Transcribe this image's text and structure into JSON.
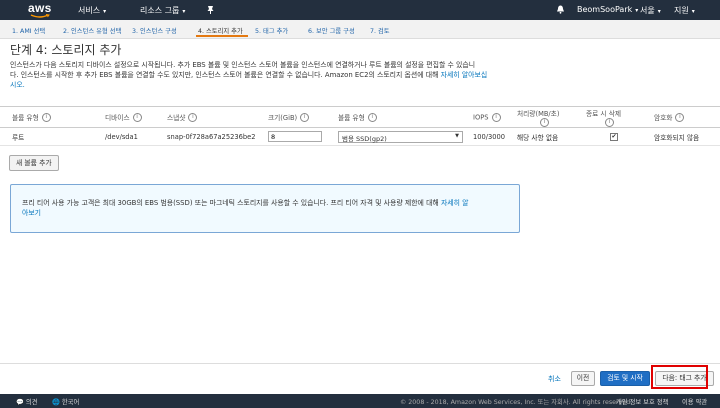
{
  "header": {
    "logo": "aws",
    "services": "서비스",
    "resource_groups": "리소스 그룹",
    "account": "BeomSooPark",
    "region": "서울",
    "support": "지원"
  },
  "steps": [
    "1. AMI 선택",
    "2. 인스턴스 유형 선택",
    "3. 인스턴스 구성",
    "4. 스토리지 추가",
    "5. 태그 추가",
    "6. 보안 그룹 구성",
    "7. 검토"
  ],
  "page": {
    "title": "단계 4: 스토리지 추가",
    "intro_line1": "인스턴스가 다음 스토리지 디바이스 설정으로 시작됩니다. 추가 EBS 볼륨 및 인스턴스 스토어 볼륨을 인스턴스에 연결하거나 루트 볼륨의 설정을 편집할 수 있습니",
    "intro_line2a": "다. 인스턴스를 시작한 후 추가 EBS 볼륨을 연결할 수도 있지만, 인스턴스 스토어 볼륨은 연결할 수 없습니다. Amazon EC2의 스토리지 옵션에 대해 ",
    "intro_link": "자세히 알아보십",
    "intro_line3": "시오."
  },
  "table": {
    "headers": {
      "volume_type": "볼륨 유형",
      "device": "디바이스",
      "snapshot": "스냅샷",
      "size": "크기(GiB)",
      "vol_kind": "볼륨 유형",
      "iops": "IOPS",
      "throughput": "처리량(MB/초)",
      "delete_on_term": "종료 시 삭제",
      "encryption": "암호화"
    },
    "row": {
      "volume_type": "루트",
      "device": "/dev/sda1",
      "snapshot": "snap-0f728a67a25236be2",
      "size": "8",
      "vol_kind": "범용 SSD(gp2)",
      "iops": "100/3000",
      "throughput": "해당 사항 없음",
      "delete_on_term_checked": true,
      "encryption": "암호화되지 않음"
    }
  },
  "add_volume": "새 볼륨 추가",
  "tip": {
    "text": "프리 티어 사용 가능 고객은 최대 30GB의 EBS 범용(SSD) 또는 마그네틱 스토리지를 사용할 수 있습니다. 프리 티어 자격 및 사용량 제한에 대해 ",
    "link1": "자세히 알",
    "link2": "아보기"
  },
  "actions": {
    "cancel": "취소",
    "previous": "이전",
    "review_launch": "검토 및 시작",
    "next": "다음: 태그 추가"
  },
  "bottom": {
    "feedback": "의견",
    "language": "한국어",
    "copyright": "© 2008 - 2018, Amazon Web Services, Inc. 또는 자회사. All rights reserved.",
    "privacy": "개인 정보 보호 정책",
    "terms": "이용 약관"
  }
}
